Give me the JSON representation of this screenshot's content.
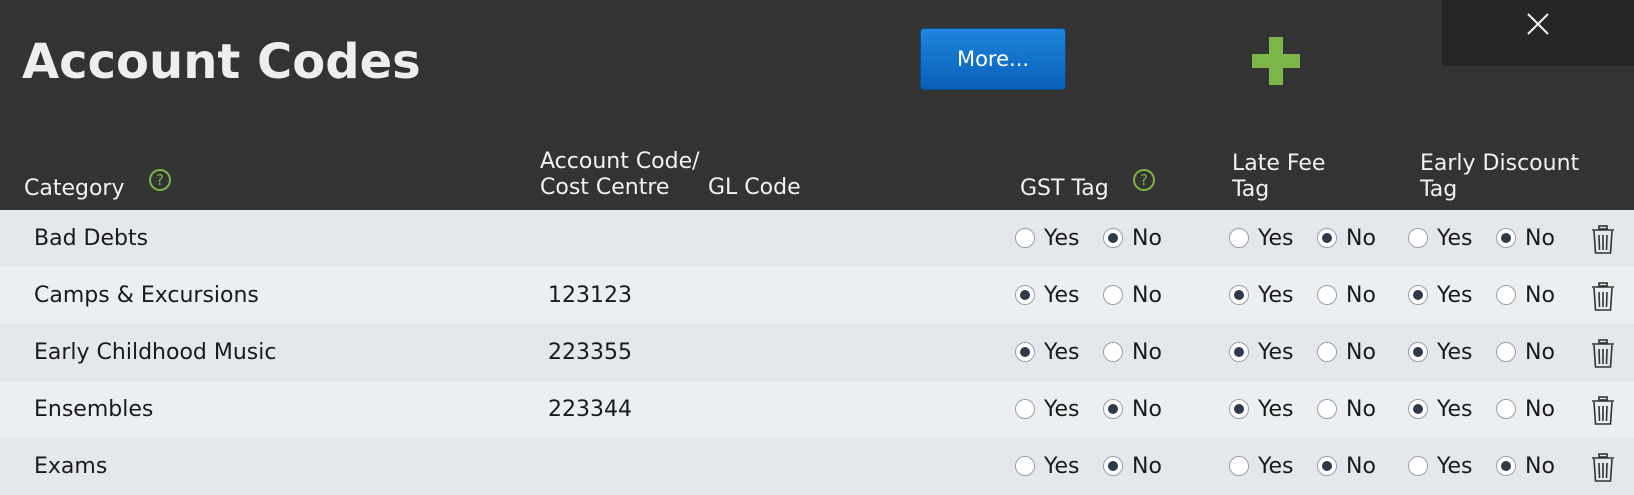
{
  "header": {
    "title": "Account Codes",
    "more_label": "More..."
  },
  "columns": {
    "category": "Category",
    "account_code_line1": "Account Code/",
    "account_code_line2": "Cost Centre",
    "gl_code": "GL Code",
    "gst_tag": "GST Tag",
    "late_fee_line1": "Late Fee",
    "late_fee_line2": "Tag",
    "early_discount_line1": "Early Discount",
    "early_discount_line2": "Tag",
    "help_glyph": "?"
  },
  "option_labels": {
    "yes": "Yes",
    "no": "No"
  },
  "icons": {
    "help": "question-circle-icon",
    "add": "plus-icon",
    "close": "close-icon",
    "delete": "trash-icon"
  },
  "colors": {
    "header_bg": "#333333",
    "accent_green": "#7ab648",
    "button_blue": "#0a5fba"
  },
  "rows": [
    {
      "category": "Bad Debts",
      "account_code": "",
      "gl_code": "",
      "gst": "no",
      "late_fee": "no",
      "early_discount": "no"
    },
    {
      "category": "Camps & Excursions",
      "account_code": "123123",
      "gl_code": "",
      "gst": "yes",
      "late_fee": "yes",
      "early_discount": "yes"
    },
    {
      "category": "Early Childhood Music",
      "account_code": "223355",
      "gl_code": "",
      "gst": "yes",
      "late_fee": "yes",
      "early_discount": "yes"
    },
    {
      "category": "Ensembles",
      "account_code": "223344",
      "gl_code": "",
      "gst": "no",
      "late_fee": "yes",
      "early_discount": "yes"
    },
    {
      "category": "Exams",
      "account_code": "",
      "gl_code": "",
      "gst": "no",
      "late_fee": "no",
      "early_discount": "no"
    }
  ]
}
